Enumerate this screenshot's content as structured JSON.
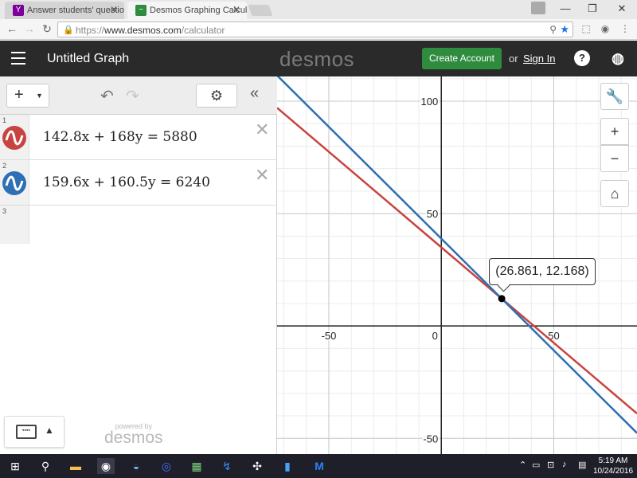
{
  "browser": {
    "tabs": [
      {
        "title": "Answer students' questio",
        "favicon": "yahoo-answers-icon",
        "active": false
      },
      {
        "title": "Desmos Graphing Calcul",
        "favicon": "desmos-icon",
        "active": true
      }
    ],
    "url_scheme": "https://",
    "url_host": "www.desmos.com",
    "url_path": "/calculator"
  },
  "header": {
    "title": "Untitled Graph",
    "logo": "desmos",
    "create_account": "Create Account",
    "or": "or",
    "sign_in": "Sign In",
    "help_glyph": "?"
  },
  "expressions": [
    {
      "index": "1",
      "latex": "142.8x + 168y = 5880",
      "color": "#c74440",
      "a": 142.8,
      "b": 168,
      "c": 5880
    },
    {
      "index": "2",
      "latex": "159.6x + 160.5y = 6240",
      "color": "#2d70b3",
      "a": 159.6,
      "b": 160.5,
      "c": 6240
    },
    {
      "index": "3",
      "latex": ""
    }
  ],
  "powered_by": {
    "small": "powered by",
    "brand": "desmos"
  },
  "graph": {
    "x_ticks": [
      "-50",
      "0",
      "50"
    ],
    "y_ticks": [
      "100",
      "50",
      "-50"
    ],
    "xlim": [
      -73,
      87
    ],
    "ylim": [
      -57,
      111
    ],
    "intersection": {
      "x": 26.861,
      "y": 12.168,
      "label": "(26.861, 12.168)"
    }
  },
  "taskbar": {
    "time": "5:19 AM",
    "date": "10/24/2016"
  }
}
